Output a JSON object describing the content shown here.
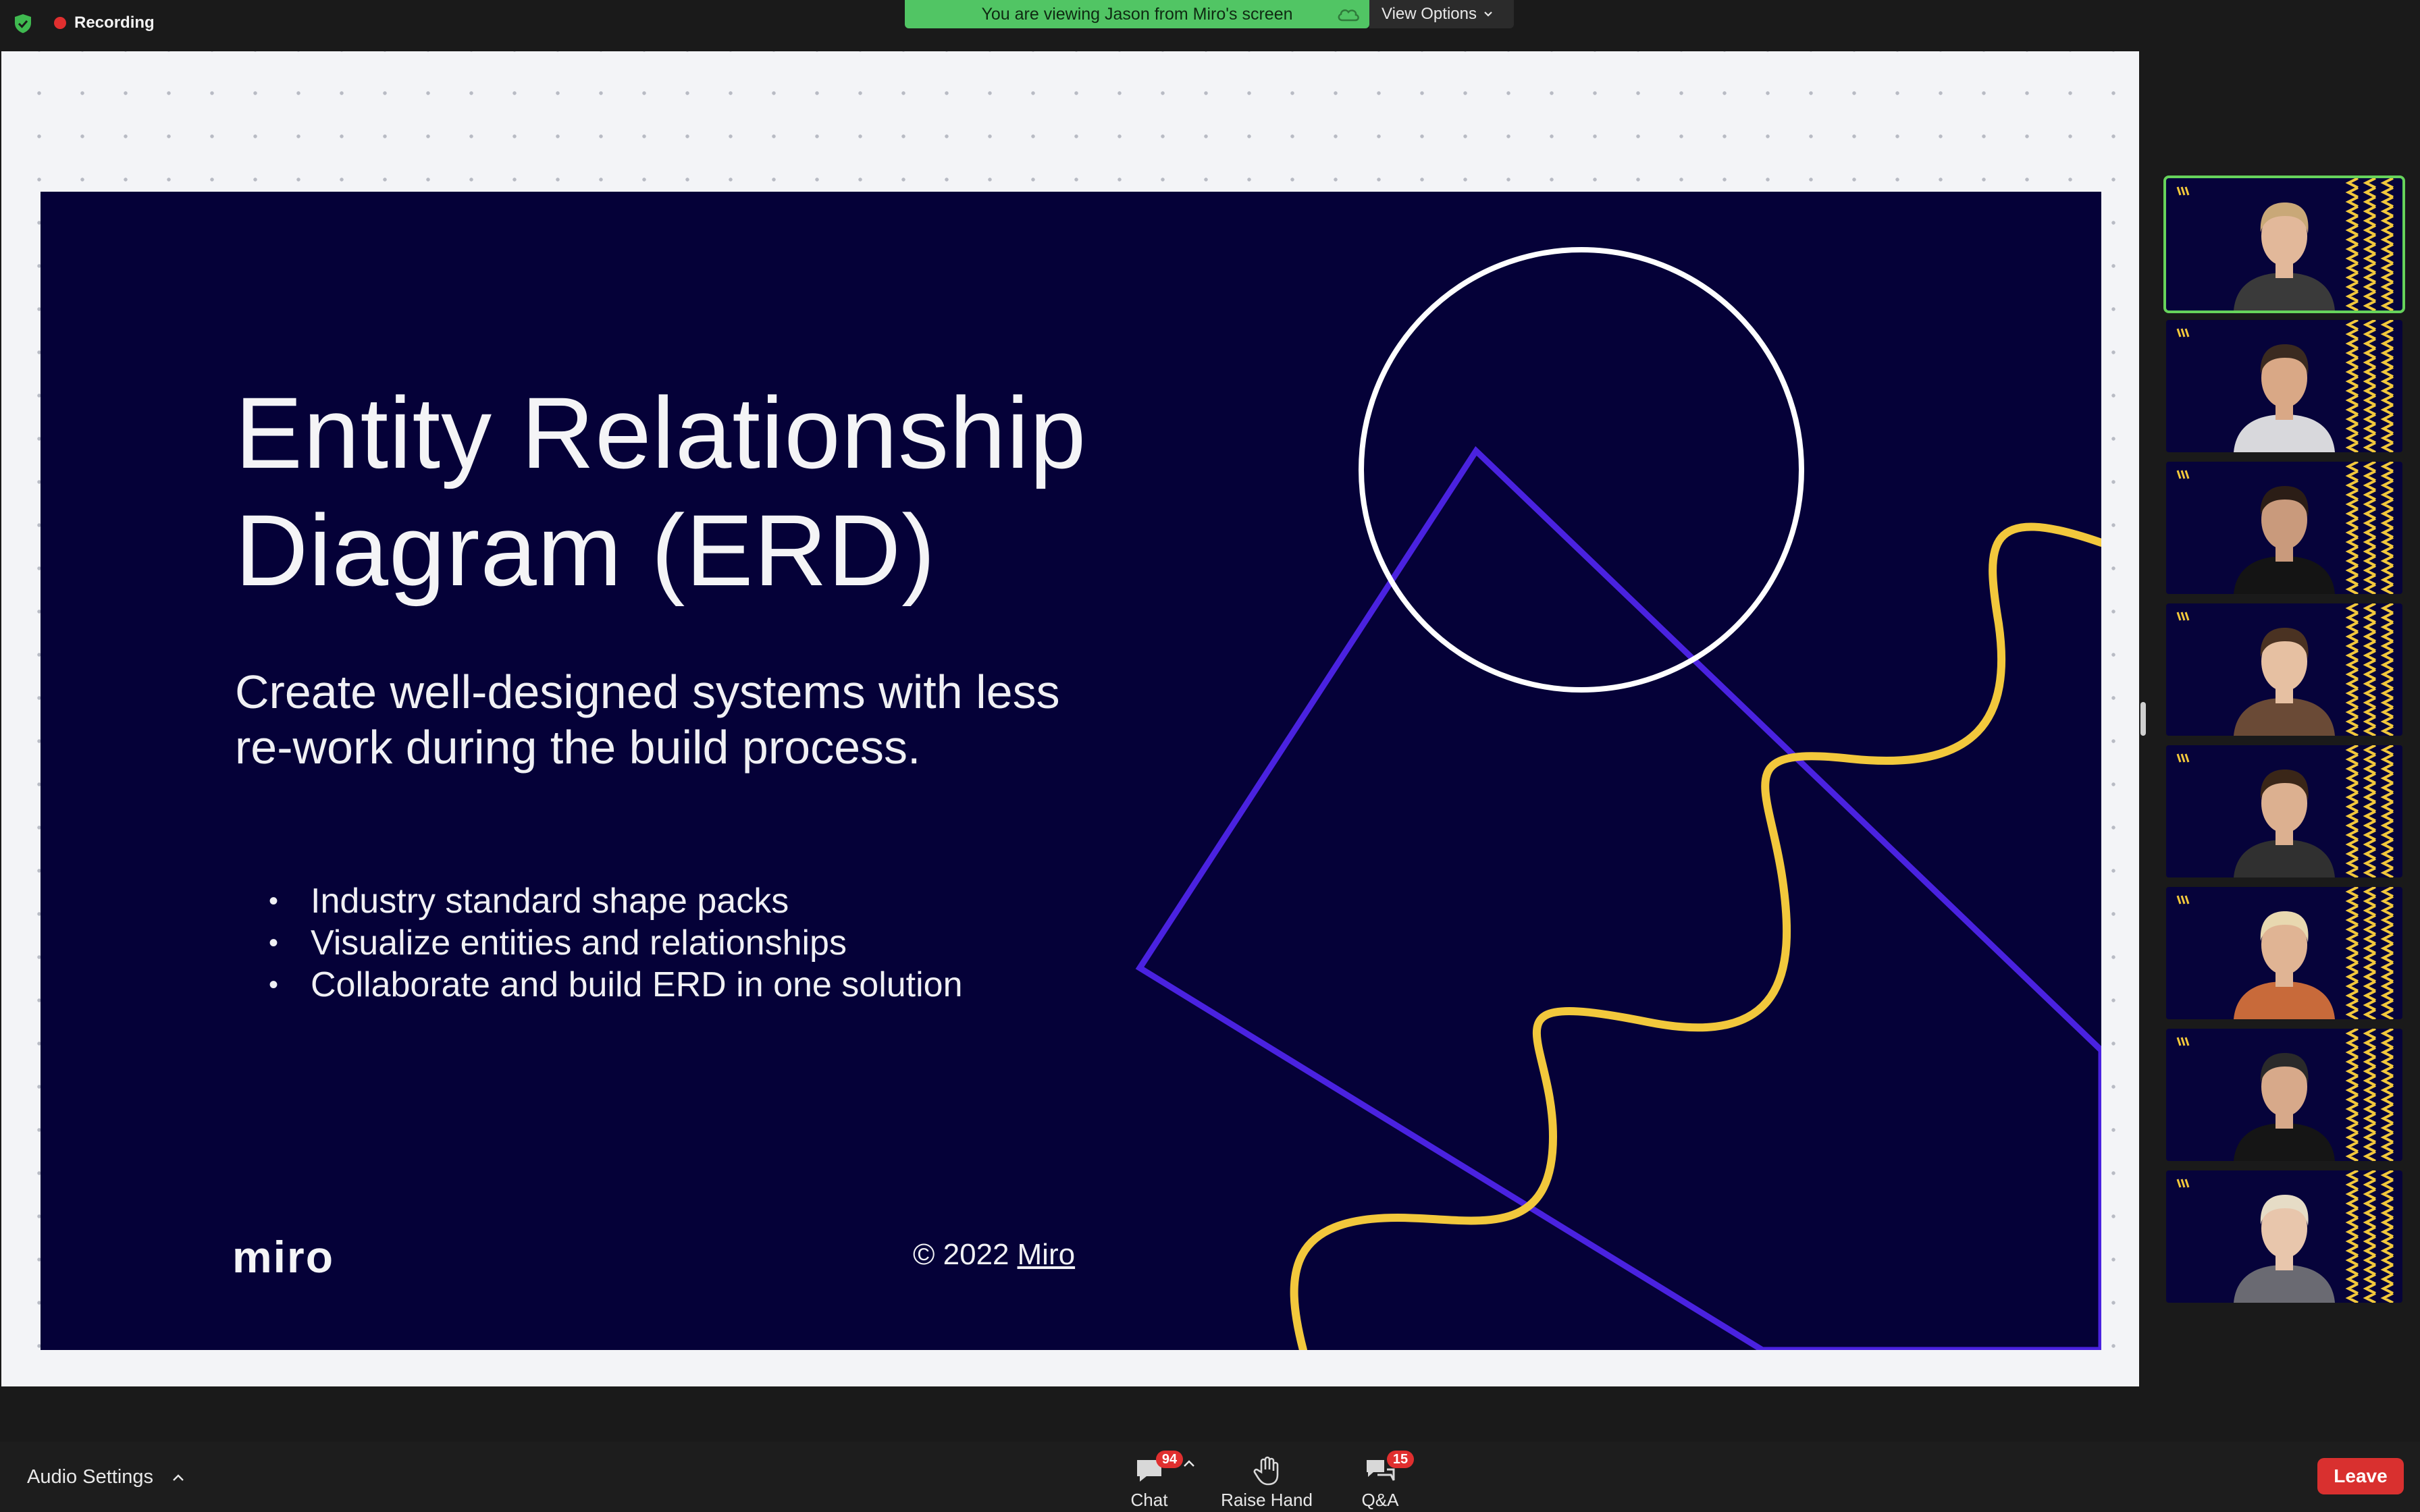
{
  "topbar": {
    "recording_label": "Recording",
    "viewing_banner": "You are viewing Jason from Miro's screen",
    "view_options_label": "View Options"
  },
  "slide": {
    "title_line1": "Entity Relationship",
    "title_line2": "Diagram (ERD)",
    "subtitle": "Create well-designed systems with less re-work during the build process.",
    "bullets": [
      "Industry standard shape packs",
      "Visualize entities and relationships",
      "Collaborate and build ERD in one solution"
    ],
    "logo_text": "miro",
    "copyright_prefix": "© 2022",
    "copyright_link": "Miro"
  },
  "participants": {
    "count": 8,
    "active_index": 0
  },
  "bottombar": {
    "audio_settings_label": "Audio Settings",
    "chat_label": "Chat",
    "chat_badge": "94",
    "raise_hand_label": "Raise Hand",
    "qa_label": "Q&A",
    "qa_badge": "15",
    "leave_label": "Leave"
  },
  "colors": {
    "slide_bg": "#050138",
    "accent_purple": "#4a22e0",
    "accent_yellow": "#f2c83c",
    "banner_green": "#51c564",
    "leave_red": "#d9302f",
    "active_tile": "#66d35b"
  },
  "icons": {
    "security": "shield-check-icon",
    "recording": "record-dot-icon",
    "cloud": "cloud-icon",
    "chat": "chat-bubble-icon",
    "raise_hand": "hand-icon",
    "qa": "qa-bubble-icon"
  }
}
